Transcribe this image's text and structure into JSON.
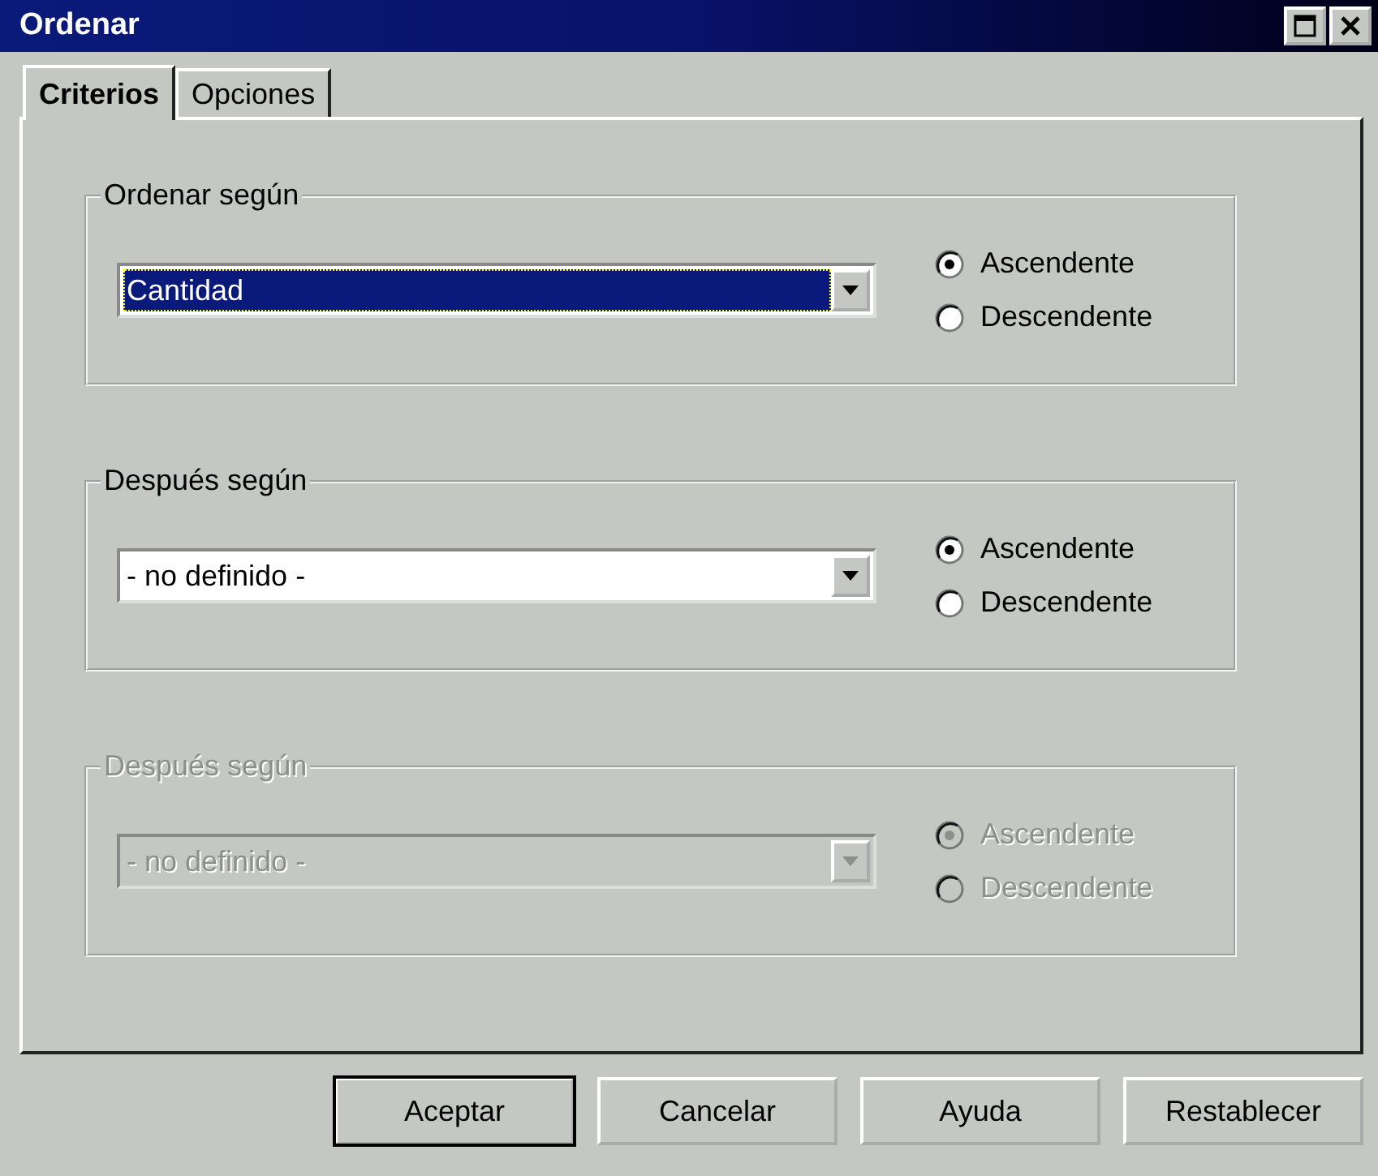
{
  "window": {
    "title": "Ordenar"
  },
  "tabs": [
    {
      "label": "Criterios",
      "selected": true
    },
    {
      "label": "Opciones",
      "selected": false
    }
  ],
  "groups": [
    {
      "title": "Ordenar según",
      "disabled": false,
      "combo": {
        "value": "Cantidad",
        "focused": true
      },
      "options": [
        {
          "label": "Ascendente",
          "selected": true
        },
        {
          "label": "Descendente",
          "selected": false
        }
      ]
    },
    {
      "title": "Después según",
      "disabled": false,
      "combo": {
        "value": "- no definido -",
        "focused": false
      },
      "options": [
        {
          "label": "Ascendente",
          "selected": true
        },
        {
          "label": "Descendente",
          "selected": false
        }
      ]
    },
    {
      "title": "Después según",
      "disabled": true,
      "combo": {
        "value": "- no definido -",
        "focused": false
      },
      "options": [
        {
          "label": "Ascendente",
          "selected": true
        },
        {
          "label": "Descendente",
          "selected": false
        }
      ]
    }
  ],
  "buttons": [
    {
      "label": "Aceptar",
      "default": true
    },
    {
      "label": "Cancelar",
      "default": false
    },
    {
      "label": "Ayuda",
      "default": false
    },
    {
      "label": "Restablecer",
      "default": false
    }
  ]
}
